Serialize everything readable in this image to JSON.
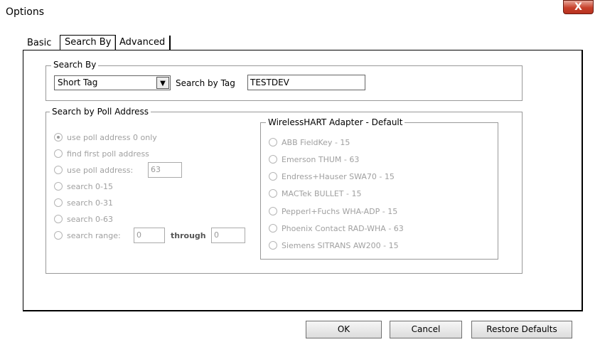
{
  "window": {
    "title": "Options",
    "close_glyph": "X"
  },
  "tabs": [
    {
      "label": "Basic",
      "active": false
    },
    {
      "label": "Search By",
      "active": true
    },
    {
      "label": "Advanced",
      "active": false
    }
  ],
  "search_by": {
    "group_label": "Search By",
    "select_value": "Short Tag",
    "tag_label": "Search by Tag",
    "tag_value": "TESTDEV"
  },
  "poll": {
    "group_label": "Search by Poll Address",
    "options": [
      {
        "label": "use poll address 0 only",
        "checked": true
      },
      {
        "label": "find first poll address",
        "checked": false
      },
      {
        "label": "use poll address:",
        "checked": false
      },
      {
        "label": "search 0-15",
        "checked": false
      },
      {
        "label": "search 0-31",
        "checked": false
      },
      {
        "label": "search 0-63",
        "checked": false
      },
      {
        "label": "search range:",
        "checked": false
      }
    ],
    "poll_address_value": "63",
    "range_from": "0",
    "through_label": "through",
    "range_to": "0"
  },
  "adapter": {
    "group_label": "WirelessHART Adapter - Default",
    "options": [
      "ABB FieldKey - 15",
      "Emerson THUM - 63",
      "Endress+Hauser SWA70 - 15",
      "MACTek BULLET - 15",
      "Pepperl+Fuchs WHA-ADP - 15",
      "Phoenix Contact RAD-WHA - 63",
      "Siemens SITRANS AW200 - 15"
    ]
  },
  "buttons": {
    "ok": "OK",
    "cancel": "Cancel",
    "restore": "Restore Defaults"
  }
}
